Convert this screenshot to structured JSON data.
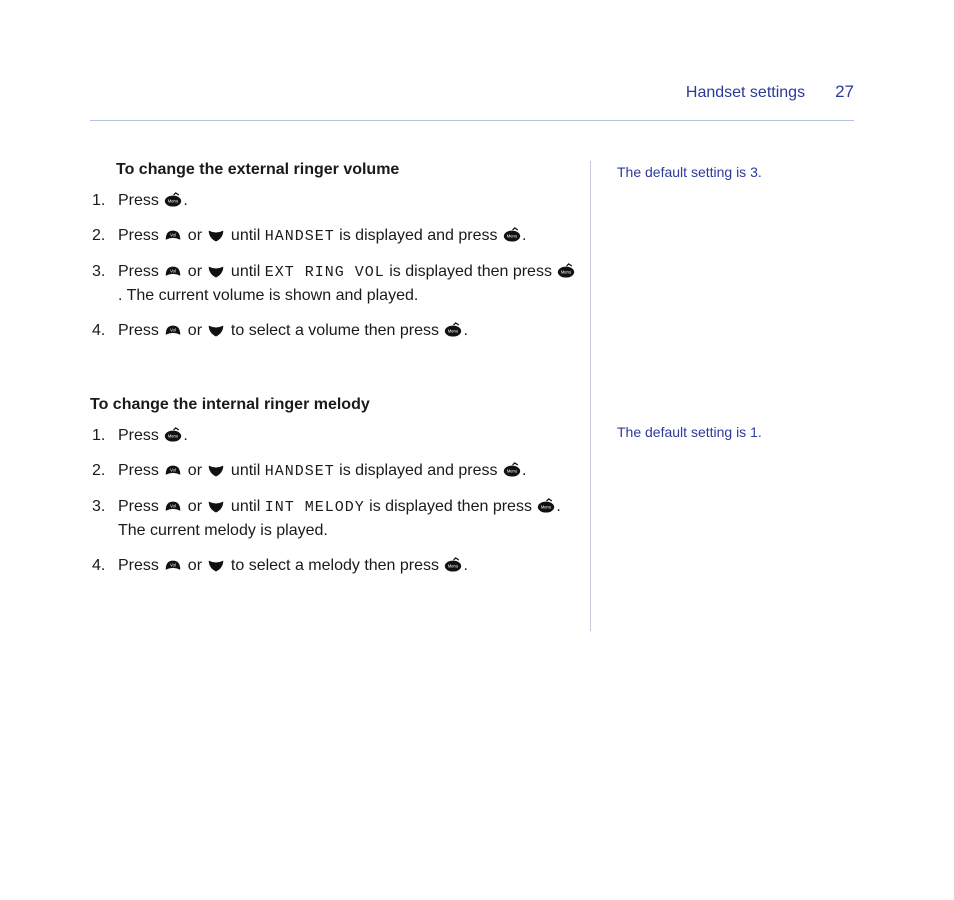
{
  "header": {
    "title": "Handset settings",
    "page": "27"
  },
  "sections": [
    {
      "heading": "To change the external ringer volume",
      "sidenote": "The default setting is 3.",
      "steps": [
        {
          "pre": "Press ",
          "post": "."
        },
        {
          "pre": "Press ",
          "mid1": " or ",
          "mid2": " until ",
          "lcd": "HANDSET",
          "mid3": " is displayed and press ",
          "post": "."
        },
        {
          "pre": "Press ",
          "mid1": " or ",
          "mid2": " until ",
          "lcd": "EXT RING VOL",
          "mid3": " is displayed then press ",
          "post": ". The current volume is shown and played."
        },
        {
          "pre": "Press ",
          "mid1": " or ",
          "mid2": " to select a volume then press ",
          "post": "."
        }
      ]
    },
    {
      "heading": "To change the internal ringer melody",
      "sidenote": "The default setting is 1.",
      "steps": [
        {
          "pre": "Press ",
          "post": "."
        },
        {
          "pre": "Press ",
          "mid1": " or ",
          "mid2": " until ",
          "lcd": "HANDSET",
          "mid3": " is displayed and press ",
          "post": "."
        },
        {
          "pre": "Press ",
          "mid1": " or ",
          "mid2": " until ",
          "lcd": "INT MELODY",
          "mid3": " is displayed then press ",
          "post": ". The current melody is played."
        },
        {
          "pre": "Press ",
          "mid1": " or ",
          "mid2": " to select a melody then press ",
          "post": "."
        }
      ]
    }
  ]
}
